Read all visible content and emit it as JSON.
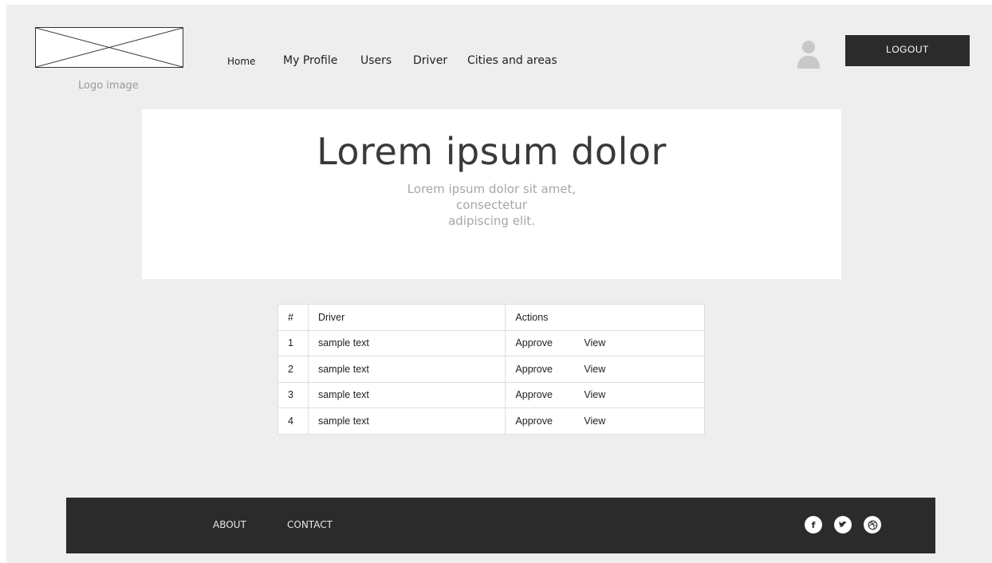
{
  "header": {
    "logo_caption": "Logo image",
    "nav": [
      {
        "label": "Home"
      },
      {
        "label": "My Profile"
      },
      {
        "label": "Users"
      },
      {
        "label": "Driver"
      },
      {
        "label": "Cities and areas"
      }
    ],
    "logout_label": "LOGOUT"
  },
  "hero": {
    "title": "Lorem ipsum dolor",
    "subtitle_lines": [
      "Lorem ipsum dolor sit amet,",
      "consectetur",
      "adipiscing elit."
    ]
  },
  "table": {
    "headers": [
      "#",
      "Driver",
      "Actions"
    ],
    "rows": [
      {
        "num": "1",
        "driver": "sample text",
        "approve": "Approve",
        "view": "View"
      },
      {
        "num": "2",
        "driver": "sample text",
        "approve": "Approve",
        "view": "View"
      },
      {
        "num": "3",
        "driver": "sample text",
        "approve": "Approve",
        "view": "View"
      },
      {
        "num": "4",
        "driver": "sample text",
        "approve": "Approve",
        "view": "View"
      }
    ]
  },
  "footer": {
    "links": [
      {
        "label": "ABOUT"
      },
      {
        "label": "CONTACT"
      }
    ],
    "social": [
      {
        "name": "facebook-icon",
        "glyph": "f"
      },
      {
        "name": "twitter-icon",
        "glyph": "t"
      },
      {
        "name": "dribbble-icon",
        "glyph": "⊛"
      }
    ]
  },
  "colors": {
    "background": "#eeeeee",
    "dark": "#2b2b2b",
    "hero_bg": "#ffffff",
    "muted_text": "#a6a6a6"
  }
}
